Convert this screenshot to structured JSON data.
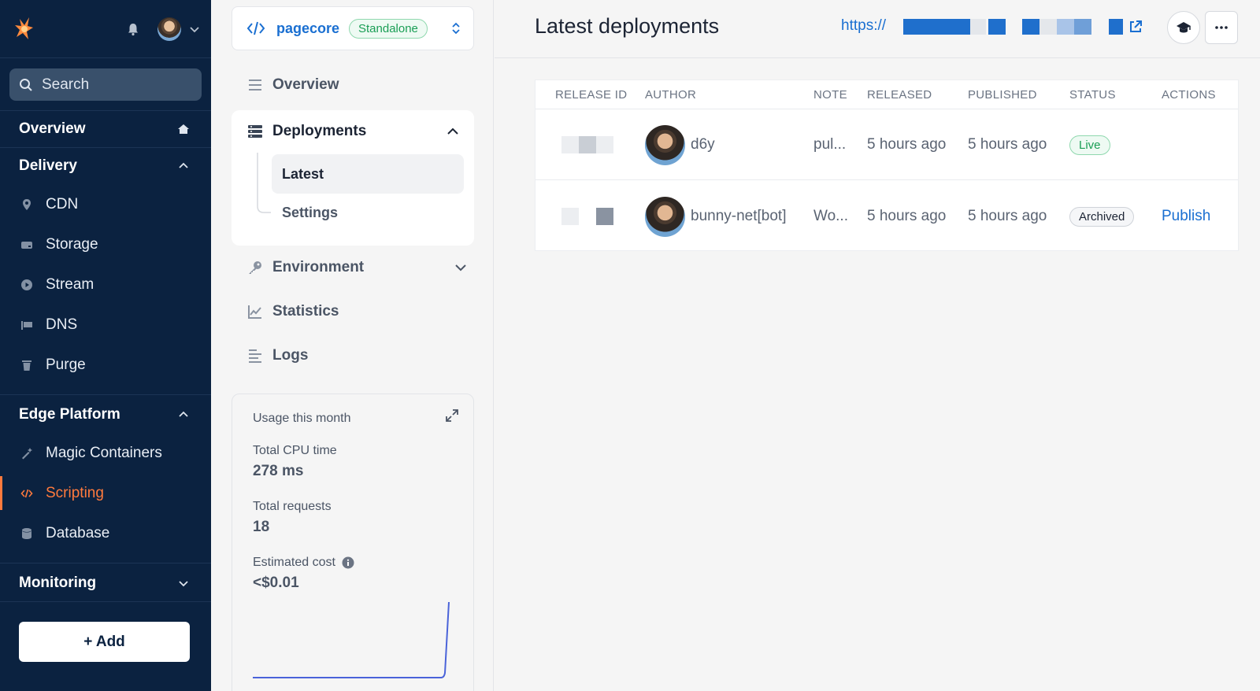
{
  "sidebar": {
    "search_label": "Search",
    "overview": "Overview",
    "delivery": {
      "title": "Delivery",
      "items": [
        "CDN",
        "Storage",
        "Stream",
        "DNS",
        "Purge"
      ]
    },
    "edge": {
      "title": "Edge Platform",
      "items": [
        "Magic Containers",
        "Scripting",
        "Database"
      ],
      "active": "Scripting"
    },
    "monitoring": "Monitoring",
    "add_label": "+ Add"
  },
  "project": {
    "name": "pagecore",
    "badge": "Standalone"
  },
  "nav": {
    "overview": "Overview",
    "deployments": "Deployments",
    "latest": "Latest",
    "settings": "Settings",
    "environment": "Environment",
    "statistics": "Statistics",
    "logs": "Logs"
  },
  "usage": {
    "title": "Usage this month",
    "cpu_label": "Total CPU time",
    "cpu_value": "278 ms",
    "req_label": "Total requests",
    "req_value": "18",
    "cost_label": "Estimated cost",
    "cost_value": "<$0.01"
  },
  "header": {
    "title": "Latest deployments",
    "url_prefix": "https://"
  },
  "table": {
    "columns": [
      "RELEASE ID",
      "AUTHOR",
      "NOTE",
      "RELEASED",
      "PUBLISHED",
      "STATUS",
      "ACTIONS"
    ],
    "rows": [
      {
        "author": "d6y",
        "note": "pul...",
        "released": "5 hours ago",
        "published": "5 hours ago",
        "status": "Live",
        "action": ""
      },
      {
        "author": "bunny-net[bot]",
        "note": "Wo...",
        "released": "5 hours ago",
        "published": "5 hours ago",
        "status": "Archived",
        "action": "Publish"
      }
    ]
  },
  "colors": {
    "sidebar_bg": "#0b2240",
    "accent": "#ff7a3d",
    "link": "#1a6fd1",
    "live": "#1a9e55"
  }
}
